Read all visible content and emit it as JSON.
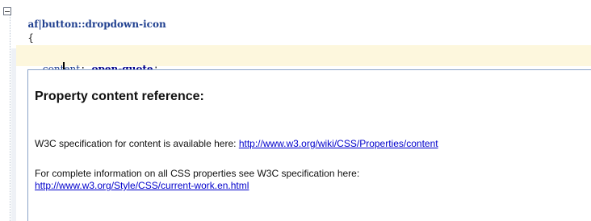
{
  "editor": {
    "selector": "af|button::dropdown-icon",
    "open_brace": "{",
    "property_before_caret": "cont",
    "property_after_caret": "ent",
    "colon": ":",
    "value": "open-quote",
    "semicolon": ";"
  },
  "popup": {
    "title": "Property content reference:",
    "spec_text": "W3C specification for content is available here:",
    "spec_link": "http://www.w3.org/wiki/CSS/Properties/content",
    "complete_text": "For complete information on all CSS properties see W3C specification here:",
    "complete_link": "http://www.w3.org/Style/CSS/current-work.en.html"
  },
  "colors": {
    "selector": "#1f3f8f",
    "value": "#00008b",
    "current_line": "#fdf7dd",
    "link": "#0000cc"
  }
}
